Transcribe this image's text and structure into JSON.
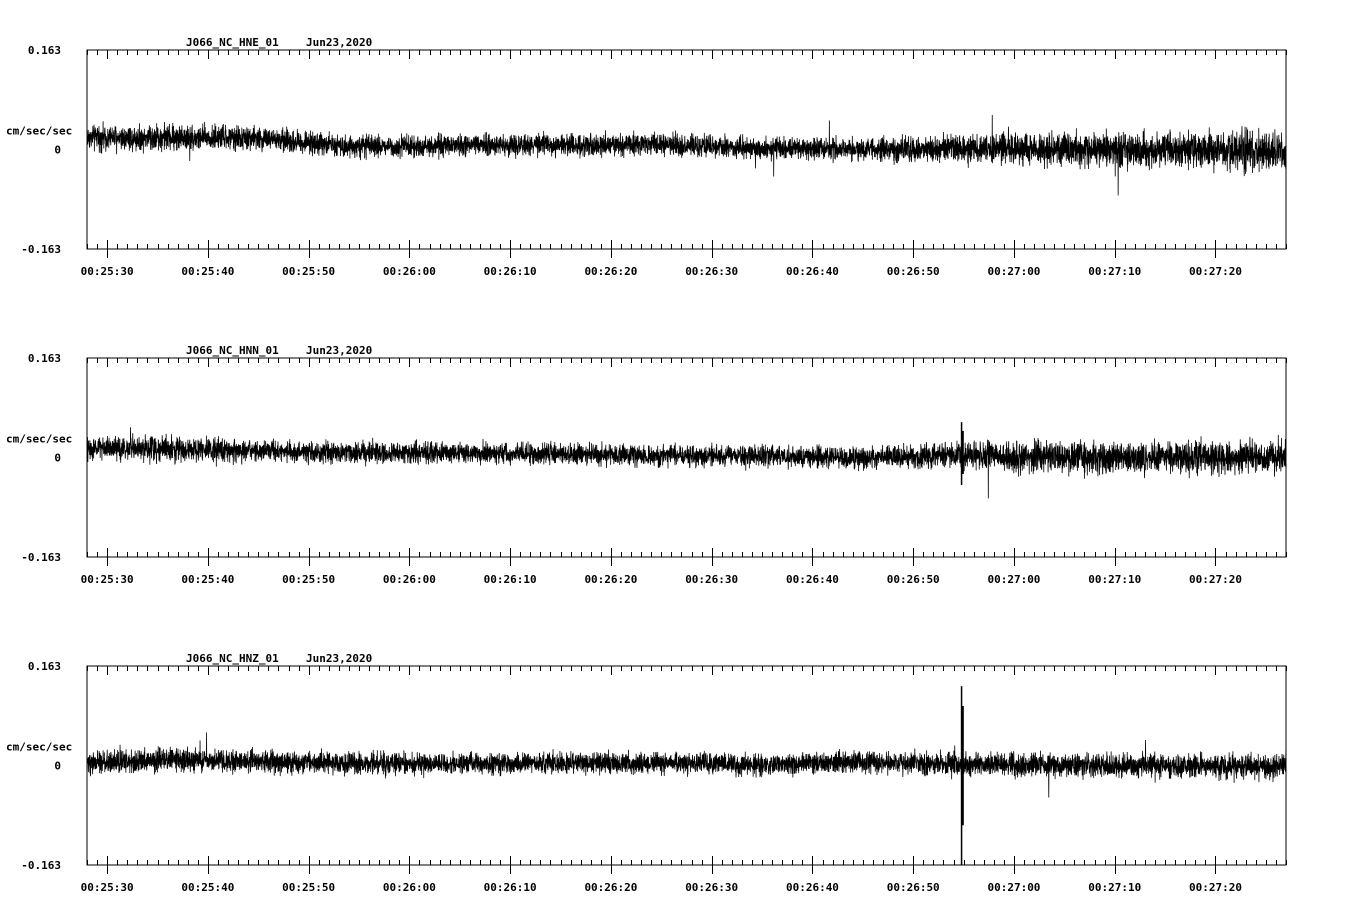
{
  "chart_data": [
    {
      "type": "line",
      "title": "J066_NC_HNE_01",
      "date": "Jun23,2020",
      "ylabel": "cm/sec/sec",
      "ylim": [
        -0.163,
        0.163
      ],
      "ytick_labels": [
        "0.163",
        "0",
        "-0.163"
      ],
      "xlim": [
        "00:25:28",
        "00:27:27"
      ],
      "xtick_labels": [
        "00:25:30",
        "00:25:40",
        "00:25:50",
        "00:26:00",
        "00:26:10",
        "00:26:20",
        "00:26:30",
        "00:26:40",
        "00:26:50",
        "00:27:00",
        "00:27:10",
        "00:27:20"
      ],
      "grid": false,
      "series": [
        {
          "x": [
            "00:25:28",
            "00:25:35",
            "00:25:45",
            "00:25:55",
            "00:26:05",
            "00:26:15",
            "00:26:25",
            "00:26:35",
            "00:26:45",
            "00:26:54",
            "00:27:05",
            "00:27:15",
            "00:27:27"
          ],
          "baseline": [
            0.02,
            0.02,
            0.018,
            0.005,
            0.006,
            0.008,
            0.008,
            0.002,
            0.0,
            0.003,
            0.0,
            0.0,
            -0.003
          ],
          "amplitude": [
            0.012,
            0.014,
            0.012,
            0.011,
            0.011,
            0.011,
            0.012,
            0.011,
            0.011,
            0.014,
            0.018,
            0.018,
            0.02
          ]
        }
      ],
      "spikes": []
    },
    {
      "type": "line",
      "title": "J066_NC_HNN_01",
      "date": "Jun23,2020",
      "ylabel": "cm/sec/sec",
      "ylim": [
        -0.163,
        0.163
      ],
      "ytick_labels": [
        "0.163",
        "0",
        "-0.163"
      ],
      "xlim": [
        "00:25:28",
        "00:27:27"
      ],
      "xtick_labels": [
        "00:25:30",
        "00:25:40",
        "00:25:50",
        "00:26:00",
        "00:26:10",
        "00:26:20",
        "00:26:30",
        "00:26:40",
        "00:26:50",
        "00:27:00",
        "00:27:10",
        "00:27:20"
      ],
      "grid": false,
      "series": [
        {
          "x": [
            "00:25:28",
            "00:25:35",
            "00:25:45",
            "00:25:55",
            "00:26:05",
            "00:26:15",
            "00:26:25",
            "00:26:35",
            "00:26:45",
            "00:26:54",
            "00:27:05",
            "00:27:15",
            "00:27:27"
          ],
          "baseline": [
            0.015,
            0.015,
            0.01,
            0.008,
            0.008,
            0.006,
            0.002,
            0.003,
            0.0,
            0.004,
            0.0,
            0.0,
            0.002
          ],
          "amplitude": [
            0.011,
            0.013,
            0.011,
            0.011,
            0.011,
            0.011,
            0.011,
            0.011,
            0.011,
            0.013,
            0.016,
            0.016,
            0.017
          ]
        }
      ],
      "spikes": [
        {
          "x": "00:26:54.8",
          "ymax": 0.058,
          "ymin": -0.045
        }
      ]
    },
    {
      "type": "line",
      "title": "J066_NC_HNZ_01",
      "date": "Jun23,2020",
      "ylabel": "cm/sec/sec",
      "ylim": [
        -0.163,
        0.163
      ],
      "ytick_labels": [
        "0.163",
        "0",
        "-0.163"
      ],
      "xlim": [
        "00:25:28",
        "00:27:27"
      ],
      "xtick_labels": [
        "00:25:30",
        "00:25:40",
        "00:25:50",
        "00:26:00",
        "00:26:10",
        "00:26:20",
        "00:26:30",
        "00:26:40",
        "00:26:50",
        "00:27:00",
        "00:27:10",
        "00:27:20"
      ],
      "grid": false,
      "series": [
        {
          "x": [
            "00:25:28",
            "00:25:35",
            "00:25:45",
            "00:25:55",
            "00:26:05",
            "00:26:15",
            "00:26:25",
            "00:26:35",
            "00:26:45",
            "00:26:54",
            "00:27:05",
            "00:27:15",
            "00:27:27"
          ],
          "baseline": [
            0.003,
            0.01,
            0.006,
            0.003,
            0.003,
            0.005,
            0.003,
            0.002,
            0.005,
            0.002,
            0.0,
            0.0,
            -0.002
          ],
          "amplitude": [
            0.011,
            0.012,
            0.011,
            0.011,
            0.011,
            0.011,
            0.011,
            0.011,
            0.011,
            0.012,
            0.012,
            0.012,
            0.013
          ]
        }
      ],
      "spikes": [
        {
          "x": "00:26:54.8",
          "ymax": 0.13,
          "ymin": -0.163
        }
      ]
    }
  ]
}
